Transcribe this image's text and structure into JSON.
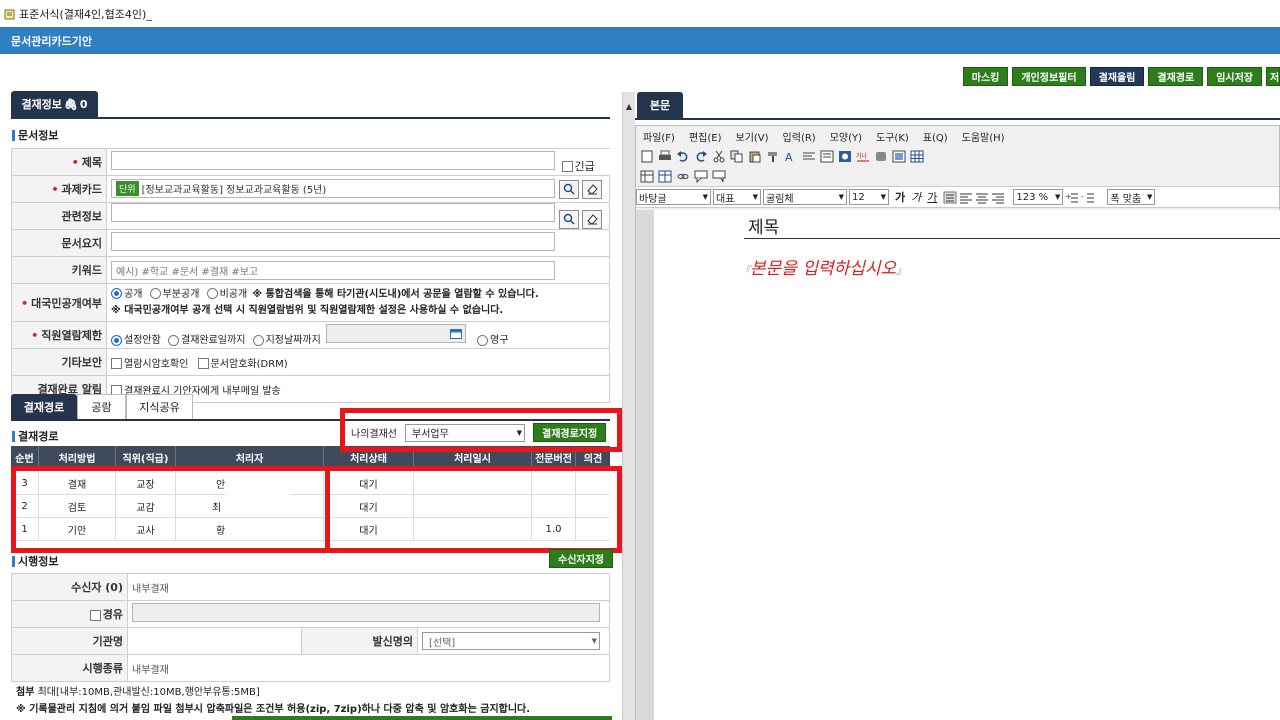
{
  "window_title": "표준서식(결재4인,협조4인)_",
  "app_title": "문서관리카드기안",
  "top_buttons": [
    "마스킹",
    "개인정보필터",
    "결재올림",
    "결재경로",
    "임시저장",
    "저"
  ],
  "left_tab": "결재정보",
  "attach_count": "0",
  "doc_info": {
    "heading": "문서정보",
    "title_label": "제목",
    "urgent_label": "긴급",
    "task_label": "과제카드",
    "task_badge": "단위",
    "task_value": "[정보교과교육활동] 정보교과교육활동 (5년)",
    "related_label": "관련정보",
    "summary_label": "문서요지",
    "keyword_label": "키워드",
    "keyword_placeholder": "예시) #학교 #문서 #결재 #보고",
    "public_label": "대국민공개여부",
    "public_options": [
      "공개",
      "부분공개",
      "비공개"
    ],
    "public_note1": "※ 통합검색을 통해 타기관(시도내)에서 공문을 열람할 수 있습니다.",
    "public_note2": "※ 대국민공개여부 공개 선택 시 직원열람범위 및 직원열람제한 설정은 사용하실 수 없습니다.",
    "staff_label": "직원열람제한",
    "staff_options": [
      "설정안함",
      "결재완료일까지",
      "지정날짜까지",
      "영구"
    ],
    "other_label": "기타보안",
    "other_options": [
      "열람시암호확인",
      "문서암호화(DRM)"
    ],
    "notify_label": "결재완료 알림",
    "notify_option": "결재완료시 기안자에게 내부메일 발송"
  },
  "route_tabs": [
    "결재경로",
    "공람",
    "지식공유"
  ],
  "route": {
    "heading": "결재경로",
    "my_line_label": "나의결재선",
    "my_line_value": "부서업무",
    "assign_button": "결재경로지정",
    "columns": [
      "순번",
      "처리방법",
      "직위(직급)",
      "처리자",
      "처리상태",
      "처리일시",
      "전문버전",
      "의견"
    ],
    "rows": [
      {
        "no": "3",
        "method": "결재",
        "position": "교장",
        "person": "안",
        "status": "대기",
        "version": ""
      },
      {
        "no": "2",
        "method": "검토",
        "position": "교감",
        "person": "최",
        "status": "대기",
        "version": ""
      },
      {
        "no": "1",
        "method": "기안",
        "position": "교사",
        "person": "황",
        "status": "대기",
        "version": "1.0"
      }
    ]
  },
  "exec": {
    "heading": "시행정보",
    "recipient_button": "수신자지정",
    "recipient_label": "수신자 (0)",
    "recipient_value": "내부결재",
    "via_label": "경유",
    "org_label": "기관명",
    "sender_label": "발신명의",
    "sender_value": "[선택]",
    "type_label": "시행종류",
    "type_value": "내부결재"
  },
  "attach": {
    "label": "첨부",
    "limit": "최대[내부:10MB,관내발신:10MB,행안부유통:5MB]",
    "note": "※ 기록물관리 지침에 의거 붙임 파일 첨부시 압축파일은 조건부 허용(zip, 7zip)하나 다중 압축 및 암호화는 금지합니다."
  },
  "editor": {
    "tab": "본문",
    "menu": [
      "파일(F)",
      "편집(E)",
      "보기(V)",
      "입력(R)",
      "모양(Y)",
      "도구(K)",
      "표(Q)",
      "도움말(H)"
    ],
    "style_value": "바탕글",
    "lang_value": "대표",
    "font_value": "굴림체",
    "size_value": "12",
    "bold": "가",
    "italic": "가",
    "underline": "가",
    "zoom_value": "123 %",
    "fit_value": "폭 맞춤",
    "doc_title": "제목",
    "body_placeholder": "본문을 입력하십시오"
  }
}
